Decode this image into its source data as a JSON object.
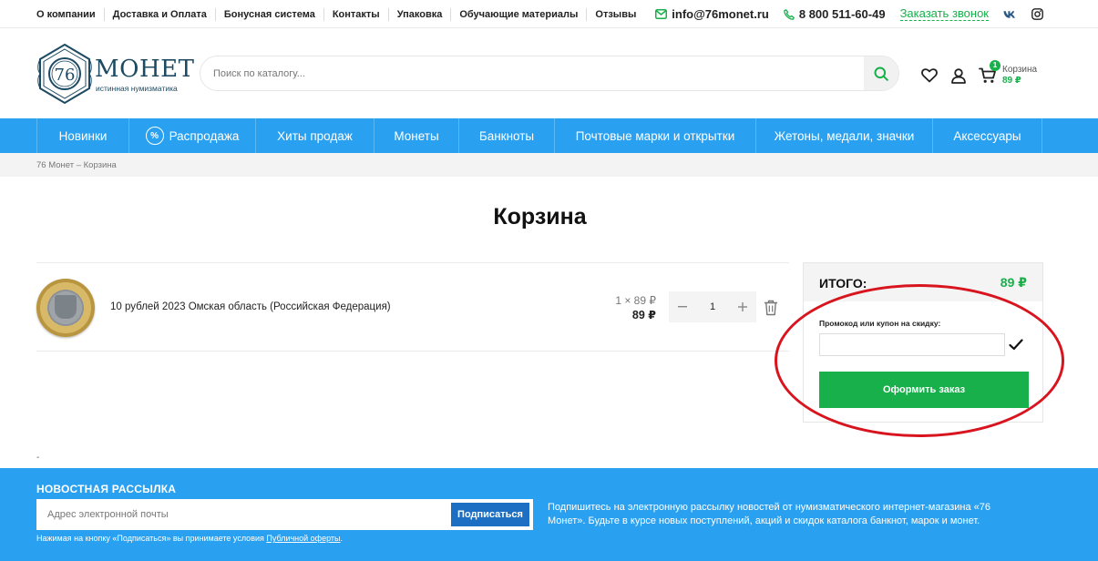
{
  "topbar": {
    "links": [
      "О компании",
      "Доставка и Оплата",
      "Бонусная система",
      "Контакты",
      "Упаковка",
      "Обучающие материалы",
      "Отзывы"
    ],
    "email": "info@76monet.ru",
    "phone": "8 800 511-60-49",
    "callback": "Заказать звонок"
  },
  "header": {
    "logo_number": "76",
    "logo_name": "МОНЕТ",
    "logo_tagline": "истинная нумизматика",
    "search_placeholder": "Поиск по каталогу...",
    "cart_count": "1",
    "cart_label": "Корзина",
    "cart_sum": "89 ₽"
  },
  "mainnav": {
    "items": [
      "Новинки",
      "Распродажа",
      "Хиты продаж",
      "Монеты",
      "Банкноты",
      "Почтовые марки и открытки",
      "Жетоны, медали, значки",
      "Аксессуары"
    ],
    "sale_symbol": "%"
  },
  "breadcrumb": "76 Монет – Корзина",
  "page_title": "Корзина",
  "cart_item": {
    "name": "10 рублей 2023 Омская область (Российская Федерация)",
    "unit_price": "1 × 89 ₽",
    "total": "89 ₽",
    "quantity": "1"
  },
  "summary": {
    "label": "ИТОГО:",
    "total": "89 ₽",
    "promo_label": "Промокод или купон на скидку:",
    "checkout_label": "Оформить заказ"
  },
  "dash": "-",
  "footer": {
    "newsletter_title": "НОВОСТНАЯ РАССЫЛКА",
    "email_placeholder": "Адрес электронной почты",
    "subscribe_label": "Подписаться",
    "note_prefix": "Нажимая на кнопку «Подписаться» вы принимаете условия ",
    "note_link": "Публичной оферты",
    "note_suffix": ".",
    "description": "Подпишитесь на электронную рассылку новостей от нумизматического интернет-магазина «76 Монет». Будьте в курсе новых поступлений, акций и скидок каталога банкнот, марок и монет."
  },
  "colors": {
    "accent_blue": "#2aa0f0",
    "accent_green": "#17b04a",
    "annotation_red": "#d8141e"
  }
}
